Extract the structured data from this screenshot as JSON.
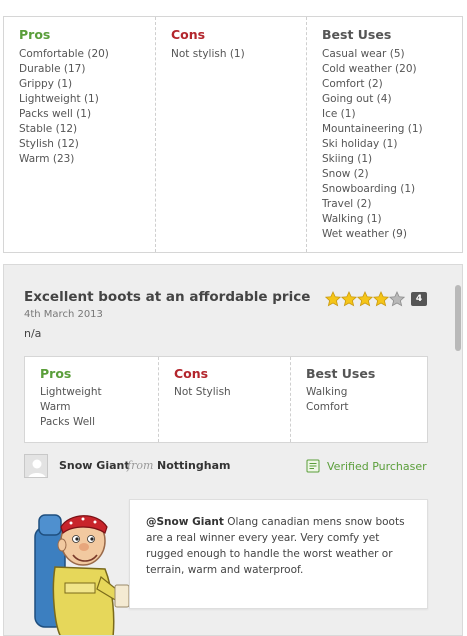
{
  "summary": {
    "pros": {
      "heading": "Pros",
      "items": [
        "Comfortable (20)",
        "Durable (17)",
        "Grippy (1)",
        "Lightweight (1)",
        "Packs well (1)",
        "Stable (12)",
        "Stylish (12)",
        "Warm (23)"
      ]
    },
    "cons": {
      "heading": "Cons",
      "items": [
        "Not stylish (1)"
      ]
    },
    "best_uses": {
      "heading": "Best Uses",
      "items": [
        "Casual wear (5)",
        "Cold weather (20)",
        "Comfort (2)",
        "Going out (4)",
        "Ice (1)",
        "Mountaineering (1)",
        "Ski holiday (1)",
        "Skiing (1)",
        "Snow (2)",
        "Snowboarding (1)",
        "Travel (2)",
        "Walking (1)",
        "Wet weather (9)"
      ]
    }
  },
  "review": {
    "title": "Excellent boots at an affordable price",
    "date": "4th March 2013",
    "body": "n/a",
    "rating": 4,
    "rating_max": 5,
    "rating_badge": "4",
    "colors": {
      "pros": "#5a9e3a",
      "cons": "#b3262d",
      "star": "#f5c518"
    },
    "pros": {
      "heading": "Pros",
      "items": [
        "Lightweight",
        "Warm",
        "Packs Well"
      ]
    },
    "cons": {
      "heading": "Cons",
      "items": [
        "Not Stylish"
      ]
    },
    "best_uses": {
      "heading": "Best Uses",
      "items": [
        "Walking",
        "Comfort"
      ]
    },
    "author": {
      "name": "Snow Giant",
      "from_label": "from",
      "location": "Nottingham",
      "verified_label": "Verified Purchaser",
      "verified_icon": "receipt-icon"
    },
    "comment": {
      "handle": "@Snow Giant",
      "text": "Olang canadian mens snow boots are a real winner every year. Very comfy yet rugged enough to handle the worst weather or terrain, warm and waterproof."
    }
  }
}
